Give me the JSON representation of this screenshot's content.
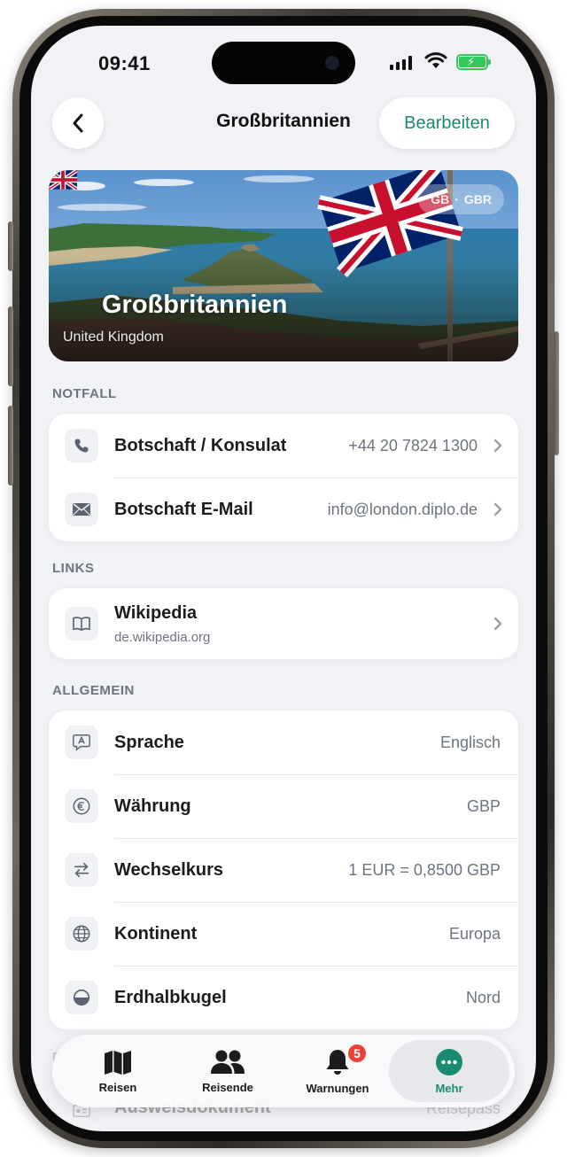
{
  "status": {
    "time": "09:41"
  },
  "nav": {
    "title": "Großbritannien",
    "edit_label": "Bearbeiten"
  },
  "hero": {
    "country": "Großbritannien",
    "subtitle": "United Kingdom",
    "code_iso2": "GB",
    "code_iso3": "GBR"
  },
  "sections": {
    "emergency": {
      "label": "NOTFALL",
      "rows": [
        {
          "label": "Botschaft / Konsulat",
          "value": "+44 20 7824 1300",
          "icon": "phone-icon"
        },
        {
          "label": "Botschaft E-Mail",
          "value": "info@london.diplo.de",
          "icon": "mail-icon"
        }
      ]
    },
    "links": {
      "label": "LINKS",
      "rows": [
        {
          "label": "Wikipedia",
          "sub": "de.wikipedia.org",
          "icon": "book-icon"
        }
      ]
    },
    "general": {
      "label": "ALLGEMEIN",
      "rows": [
        {
          "label": "Sprache",
          "value": "Englisch",
          "icon": "language-icon"
        },
        {
          "label": "Währung",
          "value": "GBP",
          "icon": "euro-icon"
        },
        {
          "label": "Wechselkurs",
          "value": "1 EUR = 0,8500 GBP",
          "icon": "exchange-icon"
        },
        {
          "label": "Kontinent",
          "value": "Europa",
          "icon": "globe-icon"
        },
        {
          "label": "Erdhalbkugel",
          "value": "Nord",
          "icon": "hemisphere-icon"
        }
      ]
    },
    "documents": {
      "partial_label": "E",
      "row_label": "Ausweisdokument",
      "row_value": "Reisepass"
    }
  },
  "tabbar": {
    "tabs": [
      {
        "label": "Reisen",
        "icon": "map-icon"
      },
      {
        "label": "Reisende",
        "icon": "people-icon"
      },
      {
        "label": "Warnungen",
        "icon": "bell-icon",
        "badge": "5"
      },
      {
        "label": "Mehr",
        "icon": "more-icon",
        "active": true
      }
    ]
  },
  "colors": {
    "accent": "#1b8a73",
    "badge": "#ee4037",
    "background": "#f1f2f5"
  }
}
